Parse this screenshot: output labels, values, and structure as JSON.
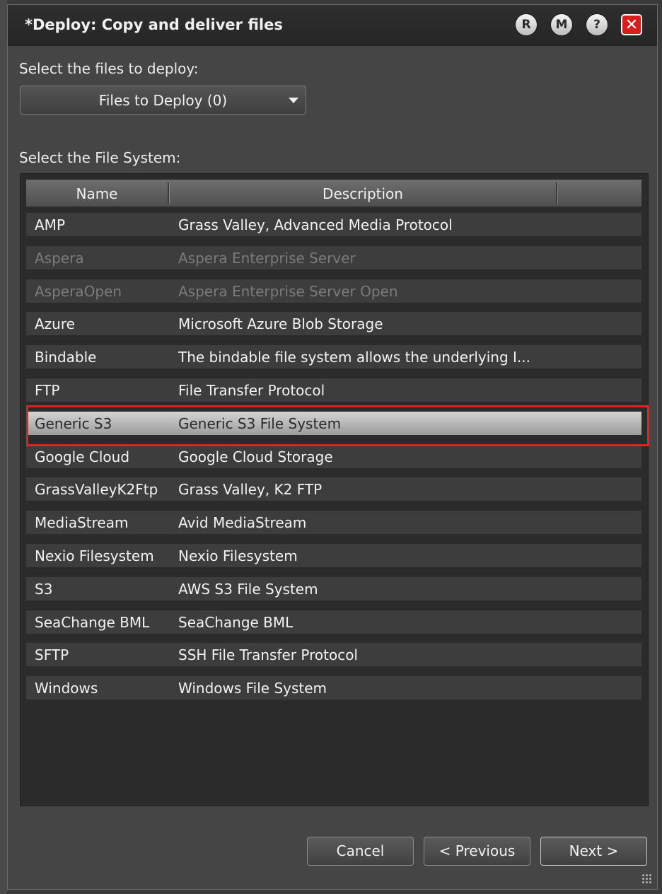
{
  "dialog": {
    "title": "*Deploy: Copy and deliver files",
    "title_buttons": [
      "R",
      "M",
      "?"
    ],
    "close_glyph": "✕"
  },
  "files_section": {
    "label": "Select the files to deploy:",
    "dropdown_value": "Files to Deploy (0)"
  },
  "fs_section": {
    "label": "Select the File System:",
    "columns": [
      "Name",
      "Description",
      ""
    ],
    "rows": [
      {
        "name": "AMP",
        "description": "Grass Valley, Advanced Media Protocol",
        "state": "normal"
      },
      {
        "name": "Aspera",
        "description": "Aspera Enterprise Server",
        "state": "disabled"
      },
      {
        "name": "AsperaOpen",
        "description": "Aspera Enterprise Server Open",
        "state": "disabled"
      },
      {
        "name": "Azure",
        "description": "Microsoft Azure Blob Storage",
        "state": "normal"
      },
      {
        "name": "Bindable",
        "description": "The bindable file system allows the underlying I...",
        "state": "normal"
      },
      {
        "name": "FTP",
        "description": "File Transfer Protocol",
        "state": "normal"
      },
      {
        "name": "Generic S3",
        "description": "Generic S3 File System",
        "state": "selected"
      },
      {
        "name": "Google Cloud",
        "description": "Google Cloud Storage",
        "state": "normal"
      },
      {
        "name": "GrassValleyK2Ftp",
        "description": "Grass Valley, K2 FTP",
        "state": "normal"
      },
      {
        "name": "MediaStream",
        "description": "Avid MediaStream",
        "state": "normal"
      },
      {
        "name": "Nexio Filesystem",
        "description": "Nexio Filesystem",
        "state": "normal"
      },
      {
        "name": "S3",
        "description": "AWS S3 File System",
        "state": "normal"
      },
      {
        "name": "SeaChange BML",
        "description": "SeaChange BML",
        "state": "normal"
      },
      {
        "name": "SFTP",
        "description": "SSH File Transfer Protocol",
        "state": "normal"
      },
      {
        "name": "Windows",
        "description": "Windows File System",
        "state": "normal"
      }
    ]
  },
  "footer": {
    "cancel": "Cancel",
    "previous": "< Previous",
    "next": "Next >"
  },
  "colors": {
    "highlight": "#e0241b",
    "close_button": "#d81d1d"
  }
}
